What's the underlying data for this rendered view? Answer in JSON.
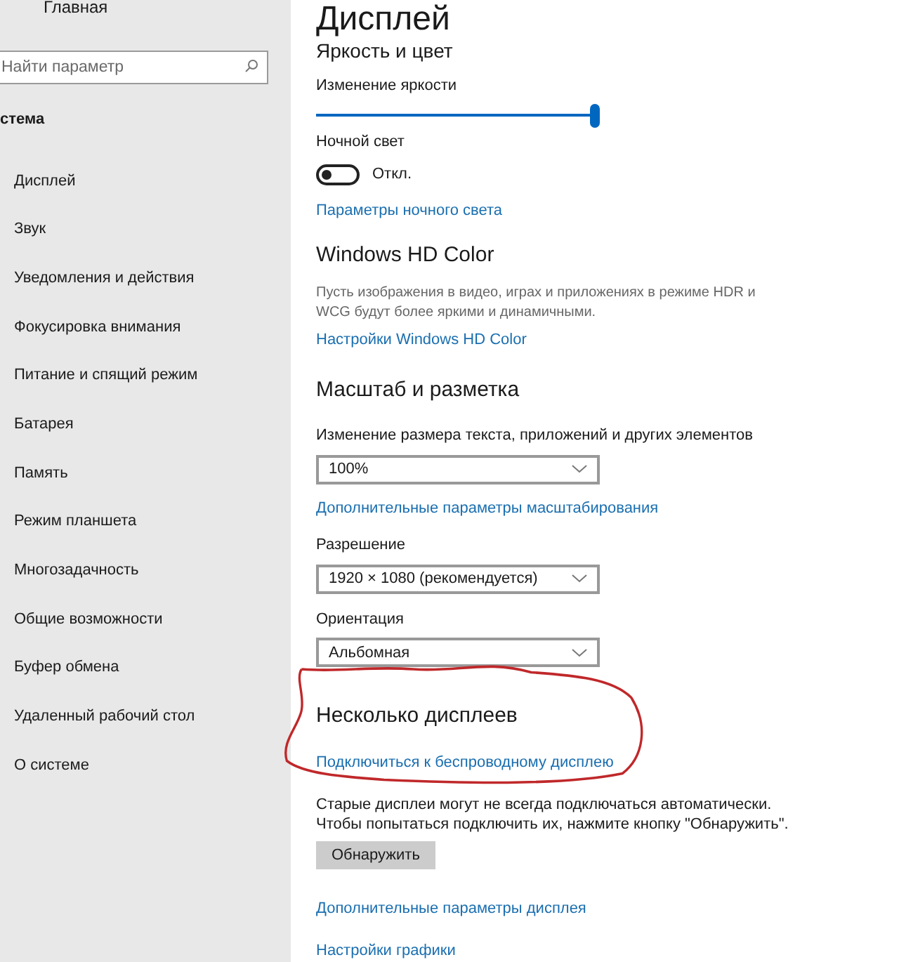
{
  "sidebar": {
    "home": "Главная",
    "search": {
      "placeholder": "Найти параметр"
    },
    "section": "стема",
    "items": [
      {
        "label": "Дисплей",
        "selected": false
      },
      {
        "label": "Звук",
        "selected": false
      },
      {
        "label": "Уведомления и действия",
        "selected": false
      },
      {
        "label": "Фокусировка внимания",
        "selected": false
      },
      {
        "label": "Питание и спящий режим",
        "selected": false
      },
      {
        "label": "Батарея",
        "selected": false
      },
      {
        "label": "Память",
        "selected": false
      },
      {
        "label": "Режим планшета",
        "selected": false
      },
      {
        "label": "Многозадачность",
        "selected": false
      },
      {
        "label": "Общие возможности",
        "selected": false
      },
      {
        "label": "Буфер обмена",
        "selected": false
      },
      {
        "label": "Удаленный рабочий стол",
        "selected": false
      },
      {
        "label": "О системе",
        "selected": false
      }
    ]
  },
  "main": {
    "title": "Дисплей",
    "section": "Яркость и цвет",
    "brightness": {
      "label": "Изменение яркости",
      "level": 1
    },
    "night_light": {
      "label": "Ночной свет",
      "on": false,
      "state": "Откл.",
      "link": "Параметры ночного света"
    },
    "hd_color": {
      "heading": "Windows HD Color",
      "description": "Пусть изображения в видео, играх и приложениях в режиме HDR и WCG будут более яркими и динамичными.",
      "link": "Настройки Windows HD Color"
    },
    "scale": {
      "heading": "Масштаб и разметка",
      "fields": [
        {
          "kind": "dropdown",
          "label": "Изменение размера текста, приложений и других элементов",
          "value": "100%"
        },
        {
          "kind": "link",
          "label": "Дополнительные параметры масштабирования"
        },
        {
          "kind": "dropdown",
          "label": "Разрешение",
          "value": "1920 × 1080 (рекомендуется)"
        },
        {
          "kind": "dropdown",
          "label": "Ориентация",
          "value": "Альбомная"
        }
      ]
    },
    "multiple": {
      "heading": "Несколько дисплеев",
      "link": "Подключиться к беспроводному дисплею",
      "note_lines": [
        "Старые дисплеи могут не всегда подключаться автоматически.",
        "Чтобы попытаться подключить их, нажмите кнопку \"Обнаружить\"."
      ],
      "button": "Обнаружить"
    },
    "links": [
      "Дополнительные параметры дисплея",
      "Настройки графики"
    ]
  }
}
